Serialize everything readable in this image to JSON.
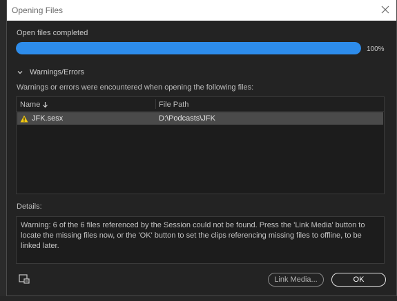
{
  "dialog": {
    "title": "Opening Files",
    "close_icon": "close-icon"
  },
  "progress": {
    "status_text": "Open files completed",
    "percent_label": "100%",
    "fraction": 1.0,
    "fill_color": "#2d8ceb"
  },
  "warnings": {
    "section_title": "Warnings/Errors",
    "description": "Warnings or errors were encountered when opening the following files:",
    "columns": {
      "name": "Name",
      "path": "File Path"
    },
    "rows": [
      {
        "icon": "warning-icon",
        "name": "JFK.sesx",
        "path": "D:\\Podcasts\\JFK"
      }
    ]
  },
  "details": {
    "label": "Details:",
    "text": "Warning: 6 of the 6 files referenced by the Session could not be found. Press the 'Link Media' button to locate the missing files now, or the 'OK' button to set the clips referencing missing files to offline, to be linked later."
  },
  "buttons": {
    "link_media": "Link Media...",
    "ok": "OK"
  },
  "colors": {
    "accent": "#2d8ceb",
    "warning": "#f2c811"
  }
}
